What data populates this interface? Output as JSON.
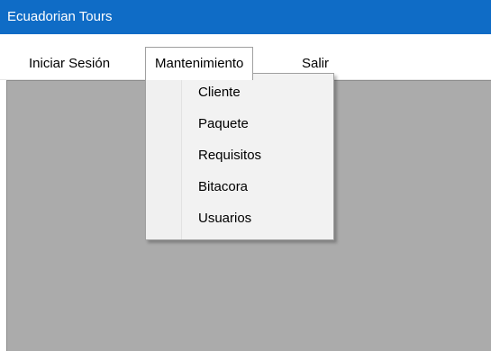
{
  "window": {
    "title": "Ecuadorian Tours"
  },
  "menubar": {
    "items": [
      {
        "label": "Iniciar Sesión"
      },
      {
        "label": "Mantenimiento"
      },
      {
        "label": "Salir"
      }
    ]
  },
  "dropdown": {
    "items": [
      {
        "label": "Cliente"
      },
      {
        "label": "Paquete"
      },
      {
        "label": "Requisitos"
      },
      {
        "label": "Bitacora"
      },
      {
        "label": "Usuarios"
      }
    ]
  },
  "colors": {
    "titlebar": "#0f6cc6",
    "client_area": "#ababab",
    "menu_background": "#f2f2f2"
  }
}
